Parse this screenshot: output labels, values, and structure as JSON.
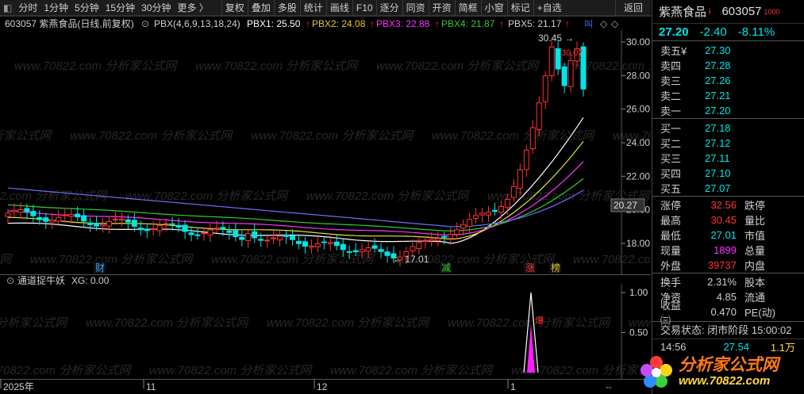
{
  "toolbar": {
    "items": [
      "分时",
      "1分钟",
      "5分钟",
      "15分钟",
      "30分钟",
      "更多",
      "复权",
      "叠加",
      "多股",
      "统计",
      "画线",
      "F10",
      "逐分",
      "同资",
      "开资",
      "简框",
      "小窗",
      "标记",
      "+自选",
      "返回"
    ]
  },
  "indicator_header": {
    "code_name": "603057 紫燕食品(日线,前复权)",
    "formula": "PBX(4,6,9,13,18,24)",
    "pbx1": "PBX1: 25.50",
    "pbx2": "PBX2: 24.08",
    "pbx3": "PBX3: 22.88",
    "pbx4": "PBX4: 21.87",
    "pbx5": "PBX5: 21.17"
  },
  "sub_header": {
    "name": "通道捉牛妖",
    "xg": "XG: 0.00"
  },
  "watermark": "www.70822.com 分析家公式网",
  "price_axis": [
    "30.00",
    "28.00",
    "26.00",
    "24.00",
    "22.00",
    "20.00",
    "18.00"
  ],
  "price_marker": "20.27",
  "sub_axis": [
    "1.00",
    "0.50"
  ],
  "date_axis": [
    "2025年",
    "11",
    "12",
    "1"
  ],
  "annotations": {
    "high": "30.45",
    "high2": "30.07",
    "low": "17.01",
    "cai": "财",
    "jian": "减",
    "zhang": "涨",
    "bang": "榜"
  },
  "stock": {
    "name": "紫燕食品",
    "code": "603057",
    "price": "27.20",
    "change": "-2.40",
    "change_pct": "-8.11%"
  },
  "order_book": {
    "asks": [
      {
        "label": "卖五¥",
        "price": "27.30"
      },
      {
        "label": "卖四",
        "price": "27.28"
      },
      {
        "label": "卖三",
        "price": "27.26"
      },
      {
        "label": "卖二",
        "price": "27.21"
      },
      {
        "label": "卖一",
        "price": "27.20"
      }
    ],
    "bids": [
      {
        "label": "买一",
        "price": "27.18"
      },
      {
        "label": "买二",
        "price": "27.12"
      },
      {
        "label": "买三",
        "price": "27.11"
      },
      {
        "label": "买四",
        "price": "27.10"
      },
      {
        "label": "买五",
        "price": "27.07"
      }
    ]
  },
  "stats": {
    "zt_label": "涨停",
    "zt": "32.56",
    "dt_label": "跌停",
    "high_label": "最高",
    "high": "30.45",
    "lb_label": "量比",
    "low_label": "最低",
    "low": "27.01",
    "sz_label": "市值",
    "xl_label": "现量",
    "xl": "1899",
    "zl_label": "总量",
    "wp_label": "外盘",
    "wp": "39737",
    "np_label": "内盘",
    "hs_label": "换手",
    "hs": "2.31%",
    "gb_label": "股本",
    "jz_label": "净资",
    "jz": "4.85",
    "lt_label": "流通",
    "sy_label": "收益㈢",
    "sy": "0.470",
    "pe_label": "PE(动)"
  },
  "trade_status": "交易状态: 闭市阶段 15:00:02",
  "tick": {
    "time": "14:56",
    "price": "27.54",
    "vol": "1.1万"
  },
  "logo": {
    "text": "分析家公式网",
    "url": "www.70822.com"
  },
  "colors": {
    "up": "#ff3333",
    "down": "#00e6e6",
    "pbx1": "#ffffff",
    "pbx2": "#e6e632",
    "pbx3": "#ff33ff",
    "pbx4": "#33cc33",
    "pbx5": "#6e6eff"
  }
}
